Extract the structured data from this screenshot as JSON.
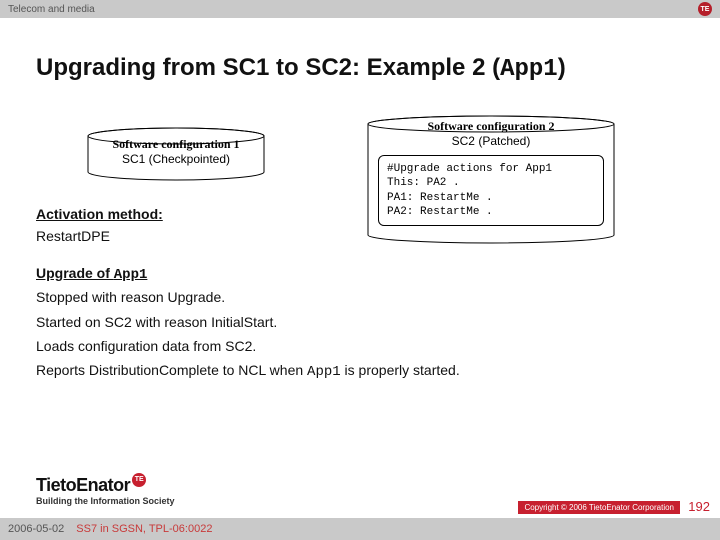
{
  "topbar": {
    "category": "Telecom and media",
    "badge": "TE"
  },
  "title": {
    "prefix": "Upgrading from SC1 to SC2: Example 2 (",
    "app": "App1",
    "suffix": ")"
  },
  "cyl1": {
    "heading": "Software configuration 1",
    "sub": "SC1 (Checkpointed)"
  },
  "cyl2": {
    "heading": "Software configuration 2",
    "sub": "SC2 (Patched)",
    "code": "#Upgrade actions for App1\nThis: PA2 .\nPA1: RestartMe .\nPA2: RestartMe ."
  },
  "body": {
    "activation_h": "Activation method:",
    "activation_v": "RestartDPE",
    "upgrade_h_pre": "Upgrade of ",
    "upgrade_h_app": "App1",
    "l1": "Stopped with reason Upgrade.",
    "l2": "Started on SC2 with reason InitialStart.",
    "l3": "Loads configuration data from SC2.",
    "l4_pre": "Reports DistributionComplete to NCL when ",
    "l4_app": "App1",
    "l4_post": " is properly started."
  },
  "brand": {
    "name": "TietoEnator",
    "dot": "TE",
    "tagline": "Building the Information Society"
  },
  "footer": {
    "date": "2006-05-02",
    "doc": "SS7 in SGSN, TPL-06:0022",
    "copyright": "Copyright © 2006 TietoEnator Corporation",
    "page": "192"
  }
}
